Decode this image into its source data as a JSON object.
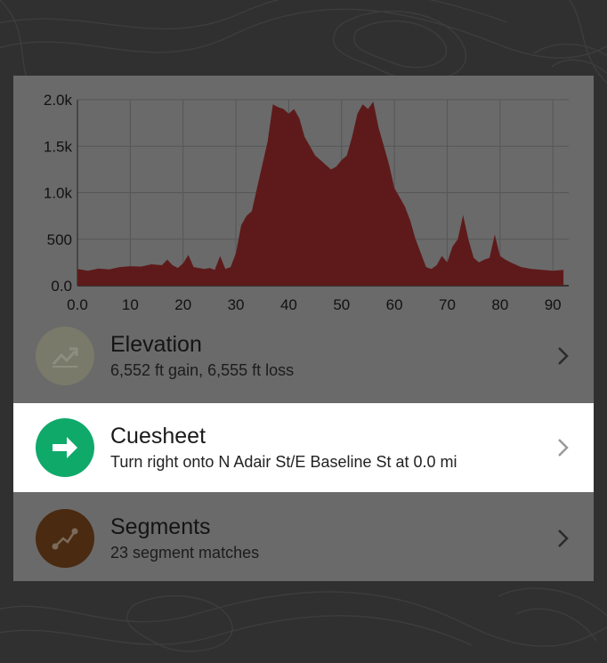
{
  "colors": {
    "backdrop": "#303030",
    "card_dim": "#6a6a6a",
    "elevation_fill": "#5e1a1a",
    "elevation_badge": "#7a7a6a",
    "cuesheet_badge": "#0fa96a",
    "segments_badge": "#4a2a10"
  },
  "chart_data": {
    "type": "area",
    "xlim": [
      0,
      93
    ],
    "ylim": [
      0,
      2000
    ],
    "x_ticks": [
      0,
      10,
      20,
      30,
      40,
      50,
      60,
      70,
      80,
      90
    ],
    "x_tick_labels": [
      "0.0",
      "10",
      "20",
      "30",
      "40",
      "50",
      "60",
      "70",
      "80",
      "90"
    ],
    "y_ticks": [
      0,
      500,
      1000,
      1500,
      2000
    ],
    "y_tick_labels": [
      "0.0",
      "500",
      "1.0k",
      "1.5k",
      "2.0k"
    ],
    "grid": true,
    "x": [
      0,
      2,
      4,
      6,
      8,
      10,
      12,
      14,
      16,
      17,
      18,
      19,
      20,
      21,
      22,
      24,
      25,
      26,
      27,
      28,
      29,
      30,
      31,
      32,
      33,
      34,
      35,
      36,
      37,
      38,
      39,
      40,
      41,
      42,
      43,
      44,
      45,
      46,
      47,
      48,
      49,
      50,
      51,
      52,
      53,
      54,
      55,
      56,
      57,
      58,
      59,
      60,
      61,
      62,
      63,
      64,
      65,
      66,
      67,
      68,
      69,
      70,
      71,
      72,
      73,
      74,
      75,
      76,
      77,
      78,
      79,
      80,
      81,
      82,
      84,
      86,
      88,
      90,
      92
    ],
    "y": [
      180,
      160,
      185,
      175,
      200,
      210,
      205,
      230,
      220,
      280,
      220,
      190,
      240,
      330,
      200,
      180,
      190,
      170,
      320,
      180,
      200,
      350,
      650,
      750,
      800,
      1050,
      1300,
      1550,
      1950,
      1920,
      1900,
      1850,
      1900,
      1800,
      1600,
      1500,
      1400,
      1350,
      1300,
      1250,
      1280,
      1350,
      1400,
      1600,
      1850,
      1950,
      1900,
      1980,
      1700,
      1500,
      1300,
      1050,
      950,
      850,
      700,
      500,
      350,
      200,
      180,
      220,
      320,
      250,
      420,
      500,
      760,
      500,
      300,
      250,
      280,
      300,
      550,
      320,
      280,
      250,
      200,
      180,
      170,
      160,
      170
    ],
    "fill_color": "#5e1a1a"
  },
  "rows": [
    {
      "title": "Elevation",
      "subtitle": "6,552 ft gain, 6,555 ft loss",
      "icon": "trending-up-icon"
    },
    {
      "title": "Cuesheet",
      "subtitle": "Turn right onto N Adair St/E Baseline St at 0.0 mi",
      "icon": "arrow-right-icon"
    },
    {
      "title": "Segments",
      "subtitle": "23 segment matches",
      "icon": "segment-route-icon"
    }
  ]
}
